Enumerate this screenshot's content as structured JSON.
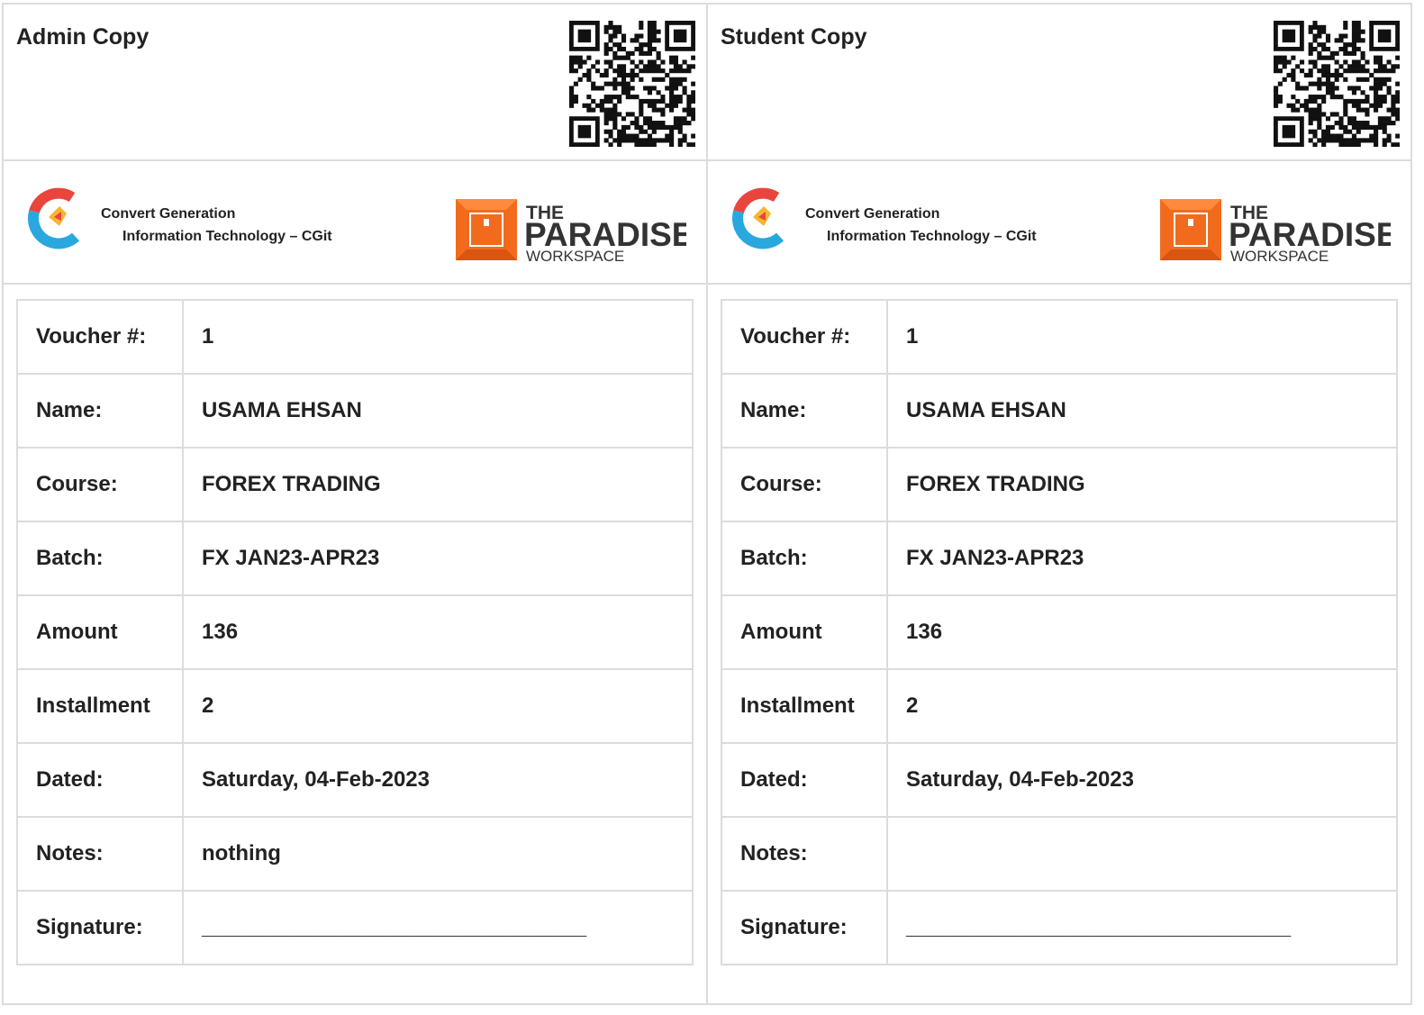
{
  "copies": [
    {
      "title": "Admin Copy",
      "org_line1": "Convert Generation",
      "org_line2": "Information Technology – CGit",
      "partner": {
        "line1": "THE",
        "line2": "PARADISE",
        "line3": "WORKSPACE"
      },
      "rows": [
        {
          "label": "Voucher #:",
          "value": "1"
        },
        {
          "label": "Name:",
          "value": "USAMA EHSAN"
        },
        {
          "label": "Course:",
          "value": "FOREX TRADING"
        },
        {
          "label": "Batch:",
          "value": "FX JAN23-APR23"
        },
        {
          "label": "Amount",
          "value": "136"
        },
        {
          "label": "Installment",
          "value": "2"
        },
        {
          "label": "Dated:",
          "value": "Saturday, 04-Feb-2023"
        },
        {
          "label": "Notes:",
          "value": "nothing"
        },
        {
          "label": "Signature:",
          "value": "________________________________"
        }
      ]
    },
    {
      "title": "Student Copy",
      "org_line1": "Convert Generation",
      "org_line2": "Information Technology – CGit",
      "partner": {
        "line1": "THE",
        "line2": "PARADISE",
        "line3": "WORKSPACE"
      },
      "rows": [
        {
          "label": "Voucher #:",
          "value": "1"
        },
        {
          "label": "Name:",
          "value": "USAMA EHSAN"
        },
        {
          "label": "Course:",
          "value": "FOREX TRADING"
        },
        {
          "label": "Batch:",
          "value": "FX JAN23-APR23"
        },
        {
          "label": "Amount",
          "value": "136"
        },
        {
          "label": "Installment",
          "value": "2"
        },
        {
          "label": "Dated:",
          "value": "Saturday, 04-Feb-2023"
        },
        {
          "label": "Notes:",
          "value": ""
        },
        {
          "label": "Signature:",
          "value": "________________________________"
        }
      ]
    }
  ],
  "colors": {
    "border": "#dcdcdc",
    "paradise_orange": "#f26b1d",
    "cgit_red": "#e8453c",
    "cgit_blue": "#29a8df",
    "cgit_yellow": "#f7b531"
  }
}
